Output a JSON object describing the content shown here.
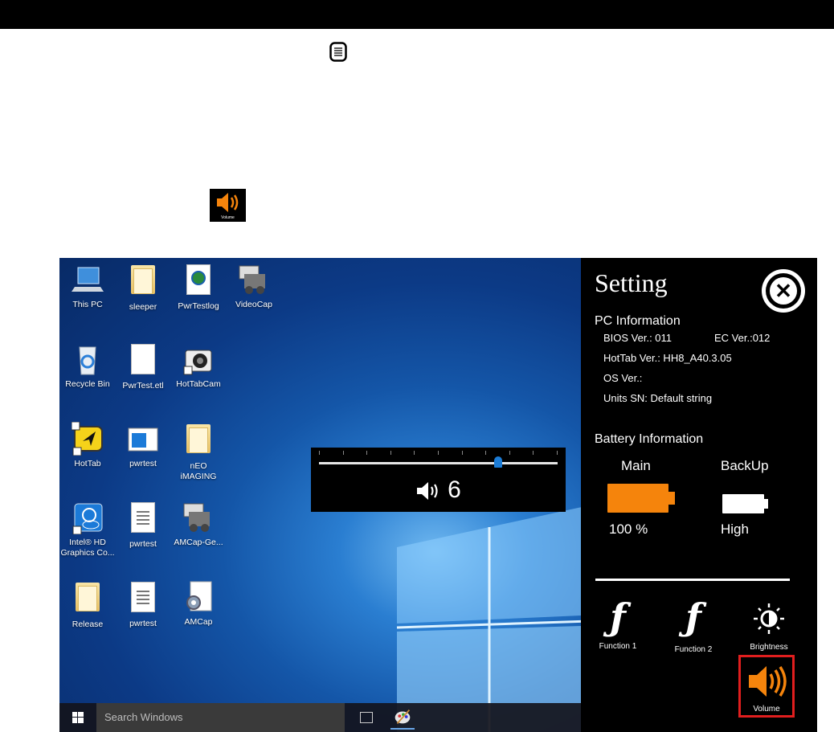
{
  "desktop": {
    "icons": [
      {
        "label": "This PC",
        "icon": "computer-icon"
      },
      {
        "label": "sleeper",
        "icon": "folder-icon"
      },
      {
        "label": "PwrTestlog",
        "icon": "web-document-icon"
      },
      {
        "label": "VideoCap",
        "icon": "video-capture-icon"
      },
      {
        "label": "Recycle Bin",
        "icon": "recycle-bin-icon"
      },
      {
        "label": "PwrTest.etl",
        "icon": "file-icon"
      },
      {
        "label": "HotTabCam",
        "icon": "camera-icon"
      },
      {
        "label": "HotTab",
        "icon": "hottab-arrow-icon"
      },
      {
        "label": "pwrtest",
        "icon": "window-app-icon"
      },
      {
        "label": "nEO iMAGING",
        "icon": "folder-icon"
      },
      {
        "label": "Intel® HD Graphics Co...",
        "icon": "intel-graphics-icon"
      },
      {
        "label": "pwrtest",
        "icon": "text-file-icon"
      },
      {
        "label": "AMCap-Ge...",
        "icon": "video-capture-icon"
      },
      {
        "label": "Release",
        "icon": "folder-icon"
      },
      {
        "label": "pwrtest",
        "icon": "text-file-icon"
      },
      {
        "label": "AMCap",
        "icon": "gear-file-icon"
      }
    ]
  },
  "volume_osd": {
    "value_text": "6",
    "level": 0.75
  },
  "taskbar": {
    "search_placeholder": "Search Windows"
  },
  "setting": {
    "title": "Setting",
    "pc_info": {
      "heading": "PC Information",
      "bios": "BIOS Ver.: 011",
      "ec": "EC Ver.:012",
      "hottab": "HotTab Ver.: HH8_A40.3.05",
      "os": "OS Ver.:",
      "sn": "Units SN: Default string"
    },
    "battery": {
      "heading": "Battery Information",
      "main_label": "Main",
      "main_value": "100 %",
      "backup_label": "BackUp",
      "backup_value": "High"
    },
    "buttons": {
      "function1": "Function 1",
      "function2": "Function 2",
      "brightness": "Brightness",
      "volume": "Volume"
    }
  },
  "doc_volume_icon_label": "Volume",
  "colors": {
    "accent_orange": "#f5840c",
    "highlight_red": "#e01e1e",
    "osd_blue": "#1c7cd6"
  }
}
